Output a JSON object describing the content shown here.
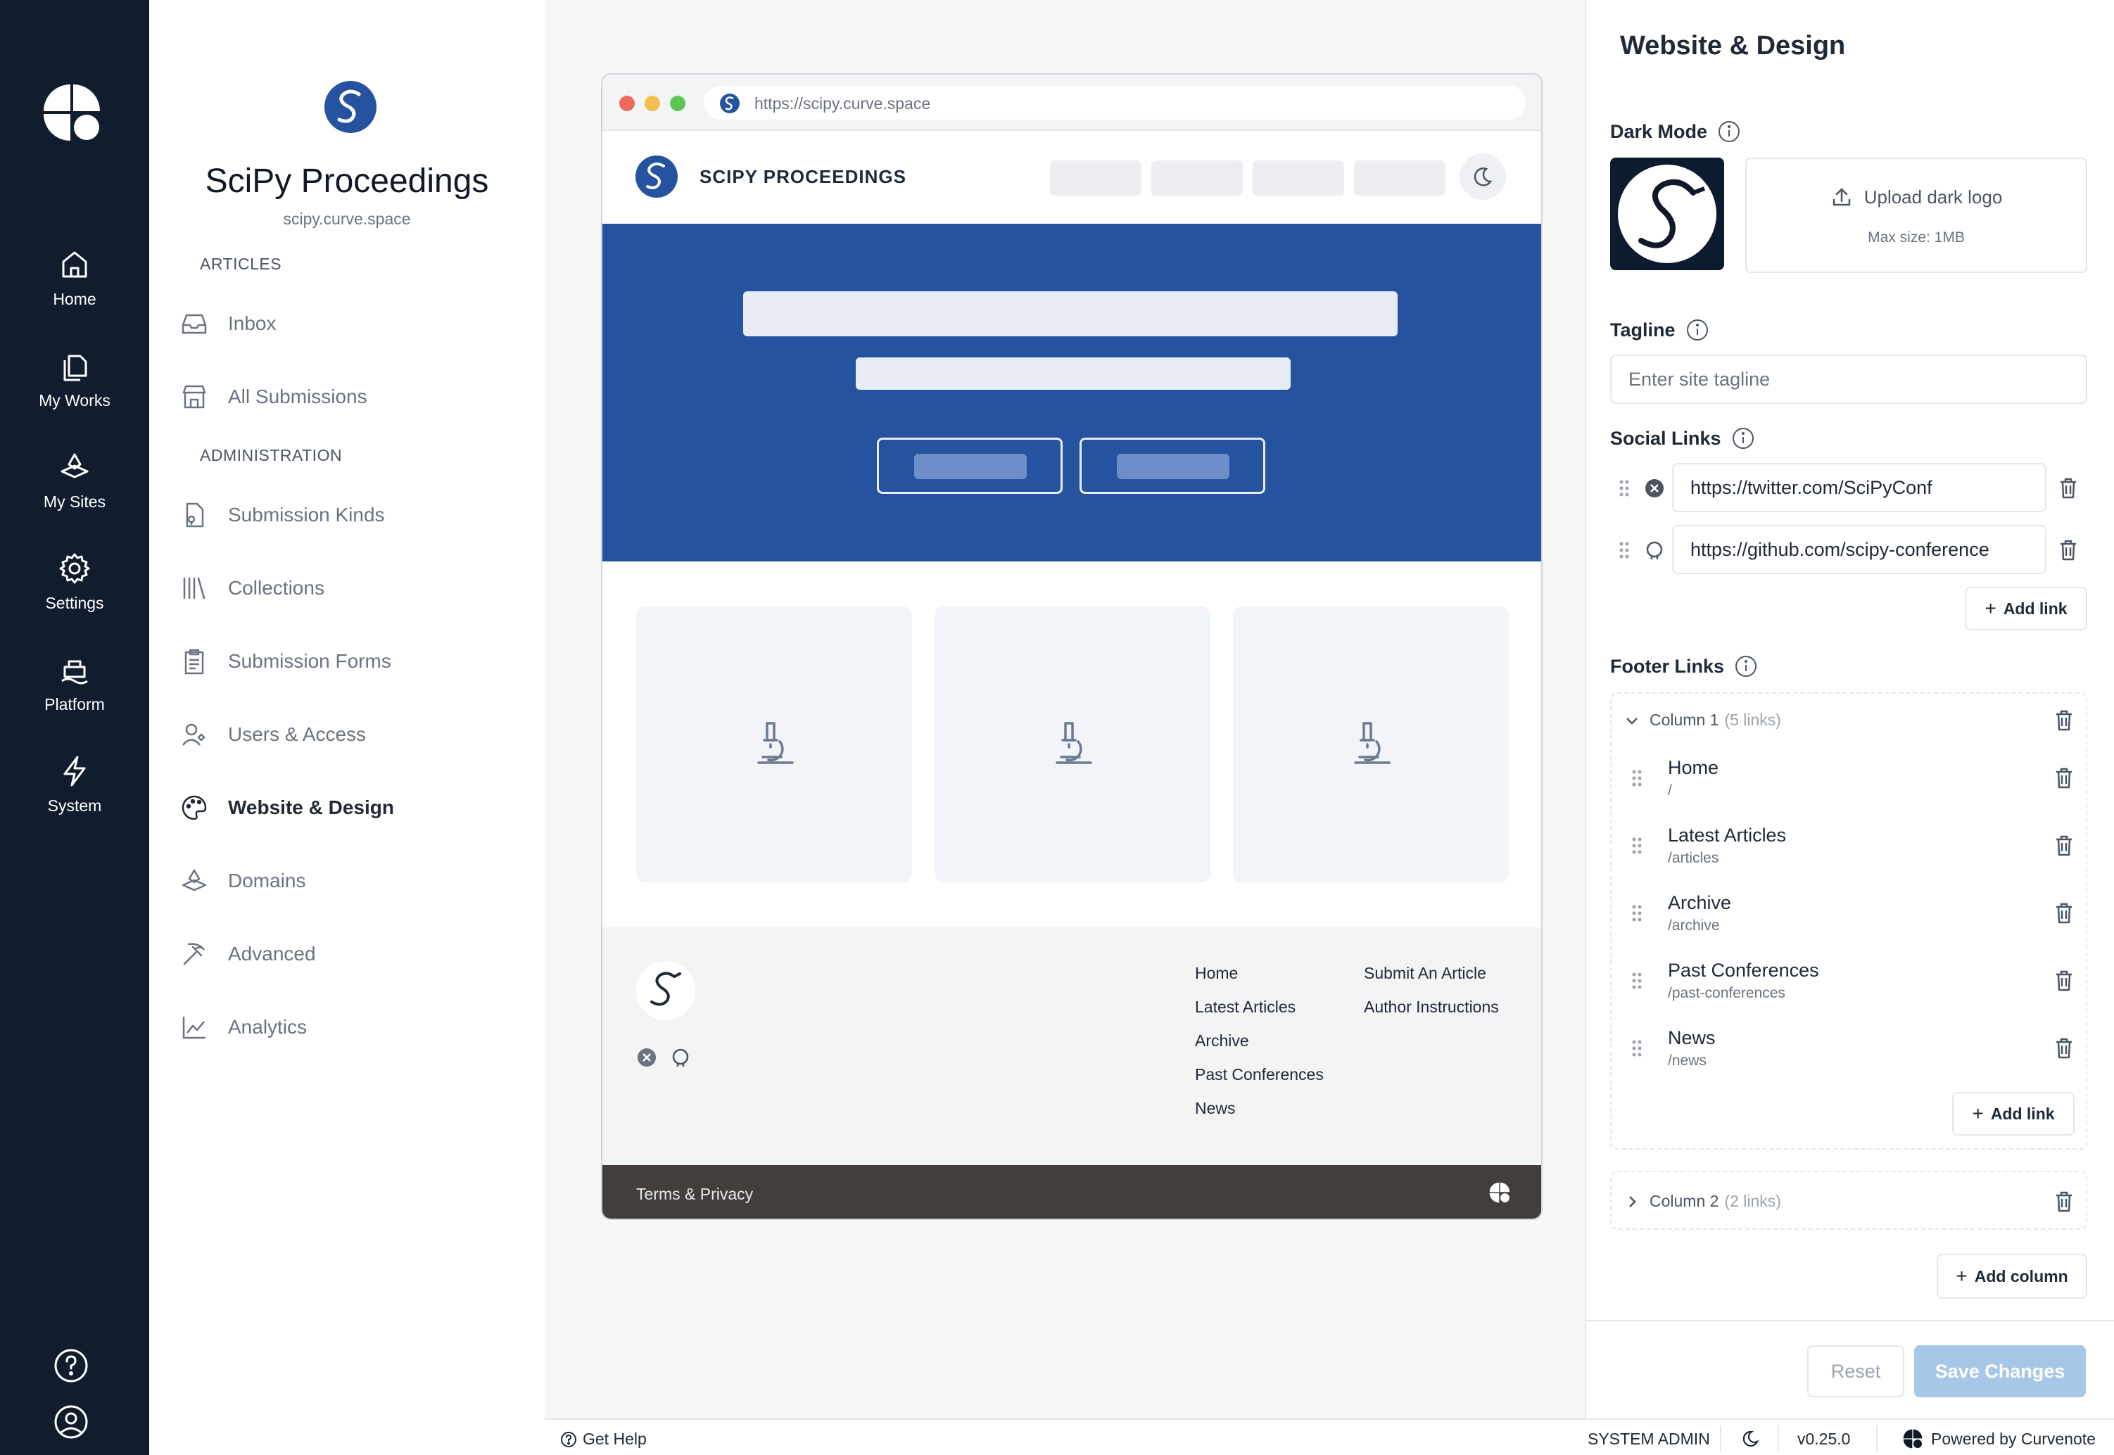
{
  "rail": {
    "items": [
      {
        "label": "Home",
        "icon": "home-icon"
      },
      {
        "label": "My Works",
        "icon": "documents-icon"
      },
      {
        "label": "My Sites",
        "icon": "sites-icon"
      },
      {
        "label": "Settings",
        "icon": "gear-icon"
      },
      {
        "label": "Platform",
        "icon": "platform-icon"
      },
      {
        "label": "System",
        "icon": "bolt-icon"
      }
    ]
  },
  "site": {
    "title": "SciPy Proceedings",
    "url": "scipy.curve.space"
  },
  "subnav": {
    "sections": [
      {
        "label": "ARTICLES"
      },
      {
        "label": "ADMINISTRATION"
      }
    ],
    "items": [
      {
        "label": "Inbox",
        "icon": "inbox-icon"
      },
      {
        "label": "All Submissions",
        "icon": "store-icon"
      },
      {
        "label": "Submission Kinds",
        "icon": "file-icon"
      },
      {
        "label": "Collections",
        "icon": "library-icon"
      },
      {
        "label": "Submission Forms",
        "icon": "clipboard-icon"
      },
      {
        "label": "Users & Access",
        "icon": "users-icon"
      },
      {
        "label": "Website & Design",
        "icon": "palette-icon"
      },
      {
        "label": "Domains",
        "icon": "domains-icon"
      },
      {
        "label": "Advanced",
        "icon": "pickaxe-icon"
      },
      {
        "label": "Analytics",
        "icon": "chart-icon"
      }
    ],
    "active": "Website & Design"
  },
  "preview": {
    "url": "https://scipy.curve.space",
    "site_name": "SCIPY PROCEEDINGS",
    "footer_col1": [
      "Home",
      "Latest Articles",
      "Archive",
      "Past Conferences",
      "News"
    ],
    "footer_col2": [
      "Submit An Article",
      "Author Instructions"
    ],
    "bottom_text": "Terms & Privacy",
    "hero_color": "#2553a0"
  },
  "panel": {
    "title": "Website & Design",
    "dark_mode_label": "Dark Mode",
    "upload_label": "Upload dark logo",
    "upload_hint": "Max size: 1MB",
    "tagline_label": "Tagline",
    "tagline_placeholder": "Enter site tagline",
    "social_label": "Social Links",
    "social_links": [
      {
        "icon": "x-icon",
        "url": "https://twitter.com/SciPyConf"
      },
      {
        "icon": "github-icon",
        "url": "https://github.com/scipy-conference"
      }
    ],
    "add_link": "Add link",
    "footer_label": "Footer Links",
    "columns": [
      {
        "name": "Column 1",
        "count": "(5 links)",
        "expanded": true,
        "links": [
          {
            "name": "Home",
            "path": "/"
          },
          {
            "name": "Latest Articles",
            "path": "/articles"
          },
          {
            "name": "Archive",
            "path": "/archive"
          },
          {
            "name": "Past Conferences",
            "path": "/past-conferences"
          },
          {
            "name": "News",
            "path": "/news"
          }
        ]
      },
      {
        "name": "Column 2",
        "count": "(2 links)",
        "expanded": false
      }
    ],
    "add_column": "Add column",
    "reset": "Reset",
    "save": "Save Changes"
  },
  "status": {
    "help": "Get Help",
    "role": "SYSTEM ADMIN",
    "version": "v0.25.0",
    "powered": "Powered by Curvenote"
  },
  "colors": {
    "rail_bg": "#111d2c",
    "accent_blue": "#2553a0",
    "save_disabled": "#a7c7e8"
  }
}
